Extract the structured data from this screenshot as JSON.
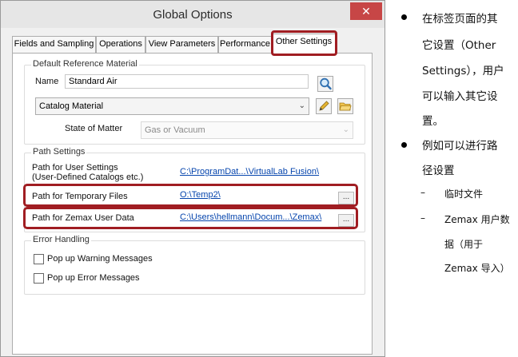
{
  "window": {
    "title": "Global Options",
    "close_glyph": "✕"
  },
  "tabs": [
    {
      "label": "Fields and Sampling"
    },
    {
      "label": "Operations"
    },
    {
      "label": "View Parameters"
    },
    {
      "label": "Performance"
    },
    {
      "label": "Other Settings",
      "active": true
    }
  ],
  "reference": {
    "group_label": "Default Reference Material",
    "name_label": "Name",
    "name_value": "Standard Air",
    "catalog_value": "Catalog Material",
    "state_label": "State of Matter",
    "state_value": "Gas or Vacuum"
  },
  "paths": {
    "group_label": "Path Settings",
    "user_settings_label_1": "Path for User Settings",
    "user_settings_label_2": "(User-Defined Catalogs etc.)",
    "user_settings_value": "C:\\ProgramDat...\\VirtualLab Fusion\\",
    "temp_label": "Path for Temporary Files",
    "temp_value": "O:\\Temp2\\",
    "zemax_label": "Path for Zemax User Data",
    "zemax_value": "C:\\Users\\hellmann\\Docum...\\Zemax\\",
    "browse_label": "..."
  },
  "errors": {
    "group_label": "Error Handling",
    "warning_label": "Pop up Warning Messages",
    "error_label": "Pop up Error Messages"
  },
  "notes": {
    "bullet1_lines": [
      "在标签页面的其",
      "它设置（Other",
      "Settings），用户",
      "可以输入其它设",
      "置。"
    ],
    "bullet2_lines": [
      "例如可以进行路",
      "径设置"
    ],
    "sub1": "临时文件",
    "sub2_lines": [
      "Zemax 用户数",
      "据（用于",
      "Zemax 导入）"
    ],
    "dash": "–"
  },
  "colors": {
    "highlight_red": "#a01d22",
    "link_blue": "#0645ad",
    "close_red": "#c74646"
  }
}
